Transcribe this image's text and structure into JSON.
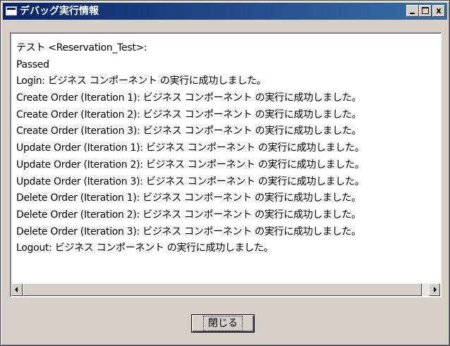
{
  "window": {
    "title": "デバッグ実行情報",
    "controls": {
      "minimize": "",
      "maximize": "",
      "close": "x"
    }
  },
  "log": {
    "lines": [
      "テスト <Reservation_Test>:",
      "Passed",
      "Login: ビジネス コンポーネント の実行に成功しました。",
      "Create Order (Iteration 1): ビジネス コンポーネント の実行に成功しました。",
      "Create Order (Iteration 2): ビジネス コンポーネント の実行に成功しました。",
      "Create Order (Iteration 3): ビジネス コンポーネント の実行に成功しました。",
      "Update Order (Iteration 1): ビジネス コンポーネント の実行に成功しました。",
      "Update Order (Iteration 2): ビジネス コンポーネント の実行に成功しました。",
      "Update Order (Iteration 3): ビジネス コンポーネント の実行に成功しました。",
      "Delete Order (Iteration 1): ビジネス コンポーネント の実行に成功しました。",
      "Delete Order (Iteration 2): ビジネス コンポーネント の実行に成功しました。",
      "Delete Order (Iteration 3): ビジネス コンポーネント の実行に成功しました。",
      "Logout: ビジネス コンポーネント の実行に成功しました。"
    ]
  },
  "scrollbar": {
    "left_icon": "arrow-left-icon",
    "right_icon": "arrow-right-icon",
    "position": 0
  },
  "buttons": {
    "close_label": "閉じる"
  },
  "colors": {
    "titlebar_start": "#0a246a",
    "titlebar_end": "#3a6ea5",
    "face": "#d4d0c8"
  }
}
